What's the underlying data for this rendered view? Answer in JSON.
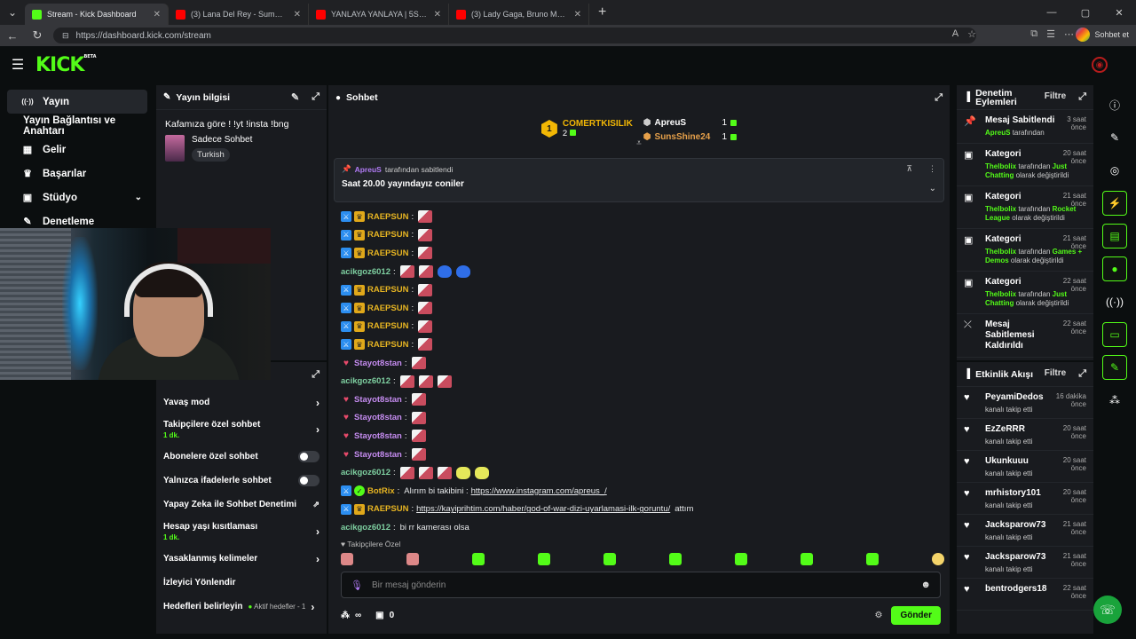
{
  "browser": {
    "tabs": [
      {
        "label": "Stream - Kick Dashboard",
        "active": true,
        "color": "#53fc18"
      },
      {
        "label": "(3) Lana Del Rey - Summertime",
        "active": false,
        "color": "#ff0000"
      },
      {
        "label": "YANLAYA YANLAYA | 5Sinders | Mu",
        "active": false,
        "color": "#ff0000"
      },
      {
        "label": "(3) Lady Gaga, Bruno Mars - Die W",
        "active": false,
        "color": "#ff0000"
      }
    ],
    "url": "https://dashboard.kick.com/stream",
    "profile_label": "Sohbet et"
  },
  "header": {
    "logo": "KICK",
    "logo_sup": "BETA"
  },
  "leftnav": {
    "items": [
      {
        "label": "Yayın",
        "icon": "stream-icon",
        "glyph": "((·))"
      },
      {
        "label": "Yayın Bağlantısı ve Anahtarı",
        "icon": "",
        "glyph": ""
      },
      {
        "label": "Gelir",
        "icon": "chart-icon",
        "glyph": "▦"
      },
      {
        "label": "Başarılar",
        "icon": "trophy-icon",
        "glyph": "🏆"
      },
      {
        "label": "Stüdyo",
        "icon": "studio-icon",
        "glyph": "▣"
      },
      {
        "label": "Denetleme",
        "icon": "wrench-icon",
        "glyph": "🔧"
      }
    ]
  },
  "info_panel": {
    "title": "Yayın bilgisi",
    "stream_title": "Kafamıza göre ! !yt !insta !bng",
    "category": "Sadece Sohbet",
    "tag": "Turkish"
  },
  "settings": {
    "slow_mode": "Yavaş mod",
    "followers_only": "Takipçilere özel sohbet",
    "followers_only_sub": "1 dk.",
    "subs_only": "Abonelere özel sohbet",
    "emotes_only": "Yalnızca ifadelerle sohbet",
    "ai_mod": "Yapay Zeka ile Sohbet Denetimi",
    "age_limit": "Hesap yaşı kısıtlaması",
    "age_limit_sub": "1 dk.",
    "banned_words": "Yasaklanmış kelimeler",
    "viewer_redirect": "İzleyici Yönlendir",
    "goals": "Hedefleri belirleyin",
    "goals_status": "Aktif hedefler - 1"
  },
  "chat": {
    "title": "Sohbet",
    "leaders": {
      "first_name": "COMERTKISILIK",
      "first_count": "2",
      "rank_badge": "1",
      "second_name": "ApreuS",
      "second_count": "1",
      "third_name": "SunsShine24",
      "third_count": "1"
    },
    "pinned_by_user": "ApreuS",
    "pinned_by_suffix": "tarafından sabitlendi",
    "pinned_message": "Saat 20.00 yayındayız coniler",
    "messages": [
      {
        "user": "RAEPSUN",
        "color": "#e6b422",
        "badges": [
          "mod",
          "vip"
        ],
        "text": "",
        "emotes": 1
      },
      {
        "user": "RAEPSUN",
        "color": "#e6b422",
        "badges": [
          "mod",
          "vip"
        ],
        "text": "",
        "emotes": 1
      },
      {
        "user": "RAEPSUN",
        "color": "#e6b422",
        "badges": [
          "mod",
          "vip"
        ],
        "text": "",
        "emotes": 1
      },
      {
        "user": "acikgoz6012",
        "color": "#7ecfa0",
        "badges": [],
        "text": "",
        "emotes": 4
      },
      {
        "user": "RAEPSUN",
        "color": "#e6b422",
        "badges": [
          "mod",
          "vip"
        ],
        "text": "",
        "emotes": 1
      },
      {
        "user": "RAEPSUN",
        "color": "#e6b422",
        "badges": [
          "mod",
          "vip"
        ],
        "text": "",
        "emotes": 1
      },
      {
        "user": "RAEPSUN",
        "color": "#e6b422",
        "badges": [
          "mod",
          "vip"
        ],
        "text": "",
        "emotes": 1
      },
      {
        "user": "RAEPSUN",
        "color": "#e6b422",
        "badges": [
          "mod",
          "vip"
        ],
        "text": "",
        "emotes": 1
      },
      {
        "user": "Stayot8stan",
        "color": "#c58cf0",
        "badges": [
          "sub"
        ],
        "text": "",
        "emotes": 1
      },
      {
        "user": "acikgoz6012",
        "color": "#7ecfa0",
        "badges": [],
        "text": "",
        "emotes": 3
      },
      {
        "user": "Stayot8stan",
        "color": "#c58cf0",
        "badges": [
          "sub"
        ],
        "text": "",
        "emotes": 1
      },
      {
        "user": "Stayot8stan",
        "color": "#c58cf0",
        "badges": [
          "sub"
        ],
        "text": "",
        "emotes": 1
      },
      {
        "user": "Stayot8stan",
        "color": "#c58cf0",
        "badges": [
          "sub"
        ],
        "text": "",
        "emotes": 1
      },
      {
        "user": "Stayot8stan",
        "color": "#c58cf0",
        "badges": [
          "sub"
        ],
        "text": "",
        "emotes": 1
      },
      {
        "user": "acikgoz6012",
        "color": "#7ecfa0",
        "badges": [],
        "text": "",
        "emotes": 5
      },
      {
        "user": "BotRix",
        "color": "#e6b422",
        "badges": [
          "mod",
          "bot"
        ],
        "text": "Alırım bi takibini : ",
        "link": "https://www.instagram.com/apreus_/",
        "emotes": 0
      },
      {
        "user": "RAEPSUN",
        "color": "#e6b422",
        "badges": [
          "mod",
          "vip"
        ],
        "text": "",
        "link": "https://kayiprihtim.com/haber/god-of-war-dizi-uyarlamasi-ilk-goruntu/",
        "after": " attım",
        "emotes": 0
      },
      {
        "user": "acikgoz6012",
        "color": "#7ecfa0",
        "badges": [],
        "text": "bi rr kamerası olsa",
        "emotes": 0
      }
    ],
    "follow_only_label": "Takipçilere Özel",
    "input_placeholder": "Bir mesaj gönderin",
    "viewer_count": "0",
    "send_label": "Gönder"
  },
  "moderation": {
    "title": "Denetim Eylemleri",
    "filter": "Filtre",
    "items": [
      {
        "icon": "pin-icon",
        "glyph": "📌",
        "title": "Mesaj Sabitlendi",
        "user": "ApreuS",
        "desc": "tarafından",
        "time": "3 saat önce"
      },
      {
        "icon": "category-icon",
        "glyph": "▣",
        "title": "Kategori",
        "user": "Thelbolix",
        "desc": "tarafından",
        "value": "Just Chatting",
        "suffix": "olarak değiştirildi",
        "time": "20 saat önce"
      },
      {
        "icon": "category-icon",
        "glyph": "▣",
        "title": "Kategori",
        "user": "Thelbolix",
        "desc": "tarafından",
        "value": "Rocket League",
        "suffix": "olarak değiştirildi",
        "time": "21 saat önce"
      },
      {
        "icon": "category-icon",
        "glyph": "▣",
        "title": "Kategori",
        "user": "Thelbolix",
        "desc": "tarafından",
        "value": "Games + Demos",
        "suffix": "olarak değiştirildi",
        "time": "21 saat önce"
      },
      {
        "icon": "category-icon",
        "glyph": "▣",
        "title": "Kategori",
        "user": "Thelbolix",
        "desc": "tarafından",
        "value": "Just Chatting",
        "suffix": "olarak değiştirildi",
        "time": "22 saat önce"
      },
      {
        "icon": "unpin-icon",
        "glyph": "⤫",
        "title": "Mesaj Sabitlemesi Kaldırıldı",
        "time": "22 saat önce"
      }
    ]
  },
  "activity": {
    "title": "Etkinlik Akışı",
    "filter": "Filtre",
    "items": [
      {
        "user": "PeyamiDedos",
        "desc": "kanalı takip etti",
        "time": "16 dakika önce"
      },
      {
        "user": "EzZeRRR",
        "desc": "kanalı takip etti",
        "time": "20 saat önce"
      },
      {
        "user": "Ukunkuuu",
        "desc": "kanalı takip etti",
        "time": "20 saat önce"
      },
      {
        "user": "mrhistory101",
        "desc": "kanalı takip etti",
        "time": "20 saat önce"
      },
      {
        "user": "Jacksparow73",
        "desc": "kanalı takip etti",
        "time": "21 saat önce"
      },
      {
        "user": "Jacksparow73",
        "desc": "kanalı takip etti",
        "time": "21 saat önce"
      },
      {
        "user": "bentrodgers18",
        "desc": "",
        "time": "22 saat önce"
      }
    ]
  }
}
